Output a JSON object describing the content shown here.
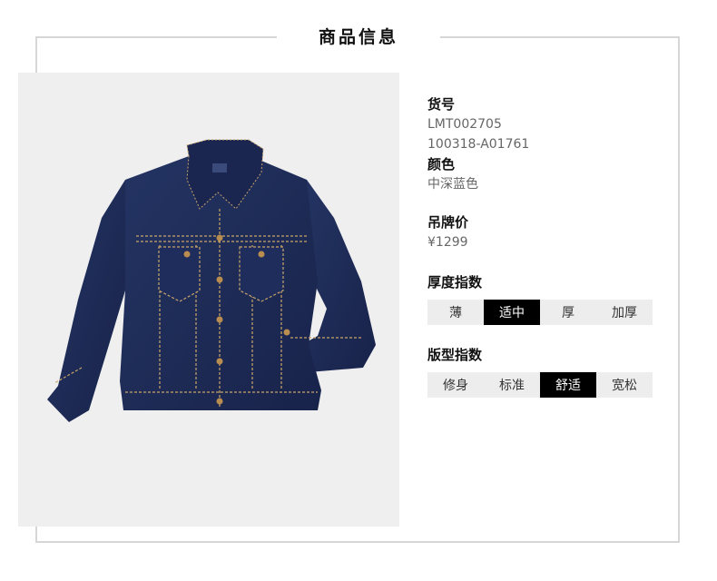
{
  "page": {
    "title": "商品信息"
  },
  "product": {
    "sku_label": "货号",
    "sku_values": [
      "LMT002705",
      "100318-A01761"
    ],
    "color_label": "颜色",
    "color_value": "中深蓝色",
    "price_label": "吊牌价",
    "price_value": "¥1299",
    "thickness": {
      "label": "厚度指数",
      "options": [
        "薄",
        "适中",
        "厚",
        "加厚"
      ],
      "selected": 1
    },
    "fit": {
      "label": "版型指数",
      "options": [
        "修身",
        "标准",
        "舒适",
        "宽松"
      ],
      "selected": 2
    },
    "image": "denim-jacket"
  },
  "colors": {
    "denim": "#1c2a55",
    "stitch": "#c9a56a",
    "frame": "#d6d6d6",
    "active": "#000000"
  }
}
